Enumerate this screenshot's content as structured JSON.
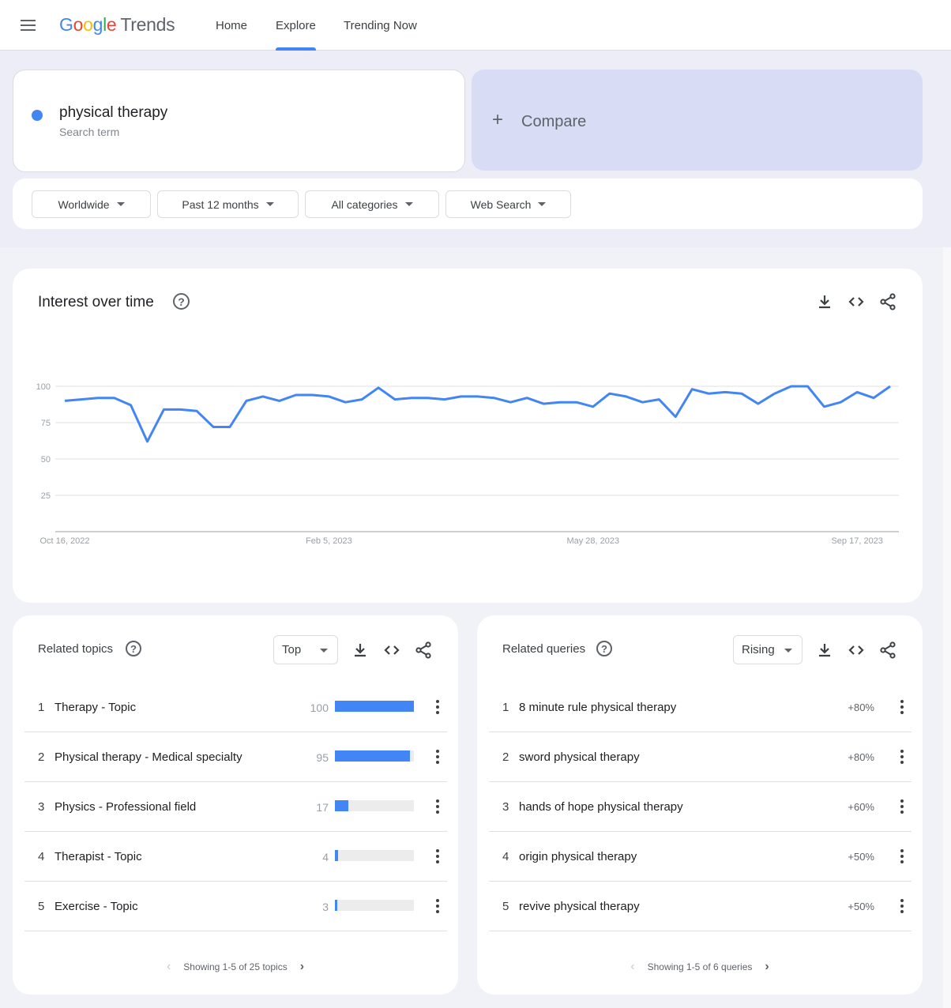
{
  "header": {
    "logo_google": [
      "G",
      "o",
      "o",
      "g",
      "l",
      "e"
    ],
    "logo_trends": "Trends",
    "nav": [
      {
        "label": "Home",
        "active": false
      },
      {
        "label": "Explore",
        "active": true
      },
      {
        "label": "Trending Now",
        "active": false
      }
    ]
  },
  "search": {
    "term": "physical therapy",
    "term_type": "Search term",
    "term_color": "#4285f4",
    "compare_label": "Compare",
    "compare_icon": "+"
  },
  "filters": [
    {
      "label": "Worldwide"
    },
    {
      "label": "Past 12 months"
    },
    {
      "label": "All categories"
    },
    {
      "label": "Web Search"
    }
  ],
  "interest_over_time": {
    "title": "Interest over time",
    "help_icon": "?"
  },
  "chart_data": {
    "type": "line",
    "title": "Interest over time",
    "xlabel": "",
    "ylabel": "",
    "ylim": [
      0,
      100
    ],
    "y_ticks": [
      25,
      50,
      75,
      100
    ],
    "x_tick_labels": [
      "Oct 16, 2022",
      "Feb 5, 2023",
      "May 28, 2023",
      "Sep 17, 2023"
    ],
    "x_tick_indices": [
      0,
      16,
      32,
      48
    ],
    "grid": true,
    "series": [
      {
        "name": "physical therapy",
        "color": "#4285f4",
        "values": [
          90,
          91,
          92,
          92,
          87,
          62,
          84,
          84,
          83,
          72,
          72,
          90,
          93,
          90,
          94,
          94,
          93,
          89,
          91,
          99,
          91,
          92,
          92,
          91,
          93,
          93,
          92,
          89,
          92,
          88,
          89,
          89,
          86,
          95,
          93,
          89,
          91,
          79,
          98,
          95,
          96,
          95,
          88,
          95,
          100,
          100,
          86,
          89,
          96,
          92,
          100
        ]
      }
    ]
  },
  "related_topics": {
    "title": "Related topics",
    "select_value": "Top",
    "items": [
      {
        "rank": "1",
        "label": "Therapy - Topic",
        "value": "100",
        "share": 100
      },
      {
        "rank": "2",
        "label": "Physical therapy - Medical specialty",
        "value": "95",
        "share": 95
      },
      {
        "rank": "3",
        "label": "Physics - Professional field",
        "value": "17",
        "share": 17
      },
      {
        "rank": "4",
        "label": "Therapist - Topic",
        "value": "4",
        "share": 4
      },
      {
        "rank": "5",
        "label": "Exercise - Topic",
        "value": "3",
        "share": 3
      }
    ],
    "pager_text": "Showing 1-5 of 25 topics"
  },
  "related_queries": {
    "title": "Related queries",
    "select_value": "Rising",
    "items": [
      {
        "rank": "1",
        "label": "8 minute rule physical therapy",
        "value": "+80%"
      },
      {
        "rank": "2",
        "label": "sword physical therapy",
        "value": "+80%"
      },
      {
        "rank": "3",
        "label": "hands of hope physical therapy",
        "value": "+60%"
      },
      {
        "rank": "4",
        "label": "origin physical therapy",
        "value": "+50%"
      },
      {
        "rank": "5",
        "label": "revive physical therapy",
        "value": "+50%"
      }
    ],
    "pager_text": "Showing 1-5 of 6 queries"
  },
  "icons": {
    "download": "download-icon",
    "embed": "embed-code-icon",
    "share": "share-icon",
    "more": "more-vert-icon",
    "prev": "‹",
    "next": "›"
  }
}
